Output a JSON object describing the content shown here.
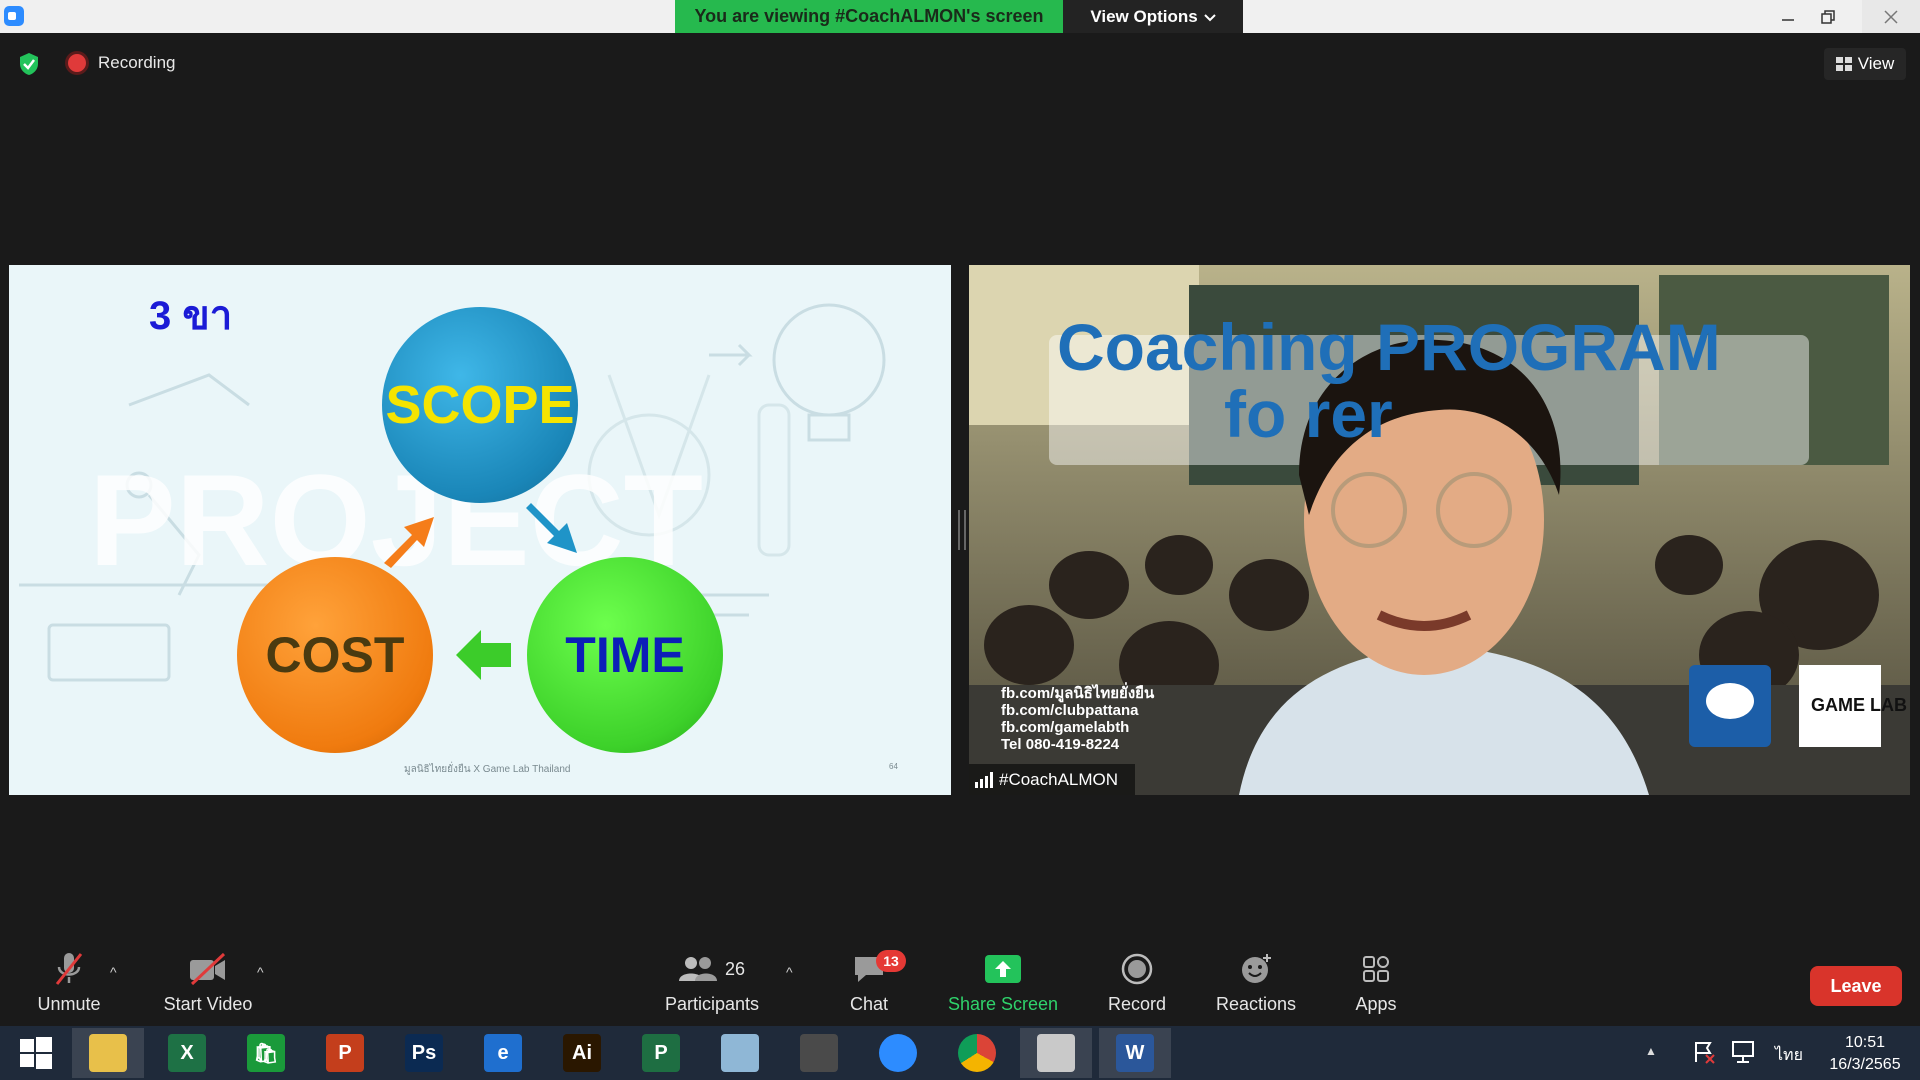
{
  "titlebar": {
    "viewing_banner": "You are viewing #CoachALMON's screen",
    "view_options": "View Options",
    "chevron": "⌄"
  },
  "meeting": {
    "recording_label": "Recording",
    "view_label": "View"
  },
  "slide": {
    "title": "3 ขา",
    "circles": {
      "scope": "SCOPE",
      "time": "TIME",
      "cost": "COST"
    },
    "credit": "มูลนิธิไทยยั่งยืน X Game Lab Thailand",
    "page": "64",
    "watermark": "PROJECT"
  },
  "camera": {
    "participant_name": "#CoachALMON",
    "banner_line1": "Coaching PROGRAM",
    "banner_line2": "fo          rer",
    "contacts": [
      "fb.com/มูลนิธิไทยยั่งยืน",
      "fb.com/clubpattana",
      "fb.com/gamelabth",
      "Tel 080-419-8224"
    ],
    "logo_text": "GAME LAB"
  },
  "toolbar": {
    "unmute": "Unmute",
    "start_video": "Start Video",
    "participants": "Participants",
    "participants_count": "26",
    "chat": "Chat",
    "chat_badge": "13",
    "share_screen": "Share Screen",
    "record": "Record",
    "reactions": "Reactions",
    "apps": "Apps",
    "leave": "Leave",
    "caret": "^"
  },
  "taskbar": {
    "apps": [
      {
        "name": "file-explorer",
        "label": "",
        "color": "#e8c04a"
      },
      {
        "name": "excel",
        "label": "X",
        "color": "#1e7145"
      },
      {
        "name": "store",
        "label": "🛍",
        "color": "#1a9a3a"
      },
      {
        "name": "powerpoint",
        "label": "P",
        "color": "#c43e1c"
      },
      {
        "name": "photoshop",
        "label": "Ps",
        "color": "#0b2a52"
      },
      {
        "name": "internet-explorer",
        "label": "e",
        "color": "#1f6fcf"
      },
      {
        "name": "illustrator",
        "label": "Ai",
        "color": "#2a1700"
      },
      {
        "name": "project",
        "label": "P",
        "color": "#1e6e42"
      },
      {
        "name": "notes",
        "label": "",
        "color": "#8fb7d6"
      },
      {
        "name": "photoscape",
        "label": "",
        "color": "#4a4a4a"
      },
      {
        "name": "zoom",
        "label": "",
        "color": "#2d8cff"
      },
      {
        "name": "chrome",
        "label": "",
        "color": "#dddddd"
      },
      {
        "name": "presentation",
        "label": "",
        "color": "#c9c9c9"
      },
      {
        "name": "word",
        "label": "W",
        "color": "#2b579a"
      }
    ],
    "language": "ไทย",
    "time": "10:51",
    "date": "16/3/2565",
    "tray_up": "▲"
  }
}
